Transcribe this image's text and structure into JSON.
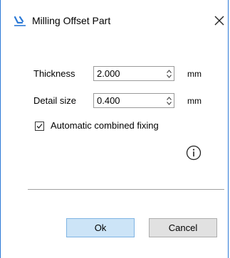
{
  "window": {
    "title": "Milling Offset Part",
    "icon": "part-icon",
    "accent_color": "#2b79d6"
  },
  "fields": {
    "thickness": {
      "label": "Thickness",
      "value": "2.000",
      "unit": "mm"
    },
    "detail_size": {
      "label": "Detail size",
      "value": "0.400",
      "unit": "mm"
    }
  },
  "options": {
    "auto_fixing": {
      "label": "Automatic combined fixing",
      "checked": true
    }
  },
  "buttons": {
    "ok": "Ok",
    "cancel": "Cancel"
  }
}
